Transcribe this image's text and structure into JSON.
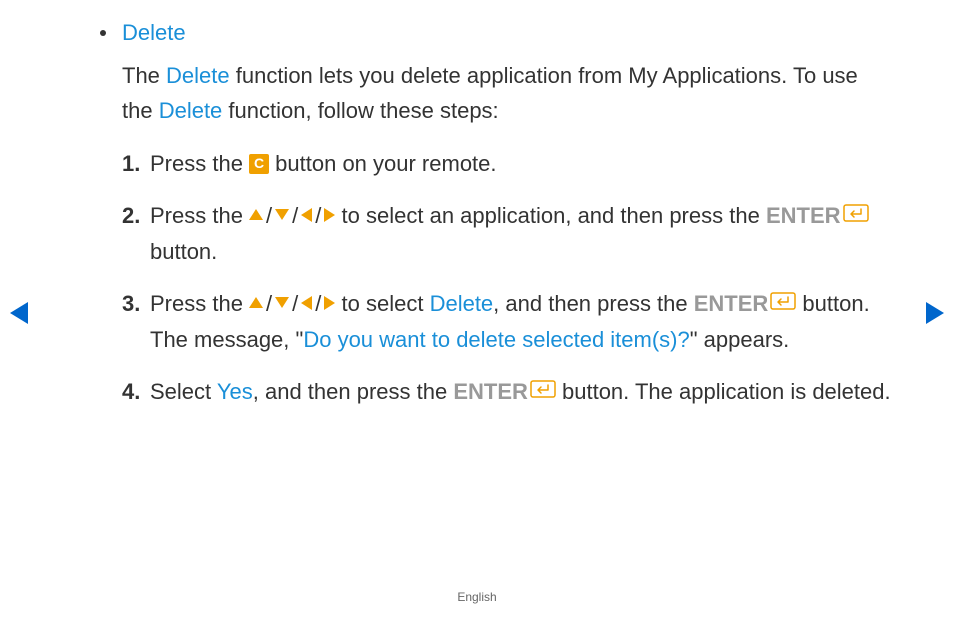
{
  "section": {
    "title": "Delete",
    "desc_part1": "The ",
    "desc_delete1": "Delete",
    "desc_part2": " function lets you delete application from My Applications. To use the ",
    "desc_delete2": "Delete",
    "desc_part3": " function, follow these steps:"
  },
  "steps": {
    "s1": {
      "a": "Press the ",
      "c": "C",
      "b": " button on your remote."
    },
    "s2": {
      "a": "Press the ",
      "b": " to select an application, and then press the ",
      "enter": "ENTER",
      "c": " button."
    },
    "s3": {
      "a": "Press the ",
      "b": " to select ",
      "delete": "Delete",
      "c": ", and then press the ",
      "enter": "ENTER",
      "d": " button. The message, \"",
      "msg": "Do you want to delete selected item(s)?",
      "e": "\" appears."
    },
    "s4": {
      "a": "Select ",
      "yes": "Yes",
      "b": ", and then press the ",
      "enter": "ENTER",
      "c": " button. The application is deleted."
    }
  },
  "slash": "/",
  "footer": "English"
}
